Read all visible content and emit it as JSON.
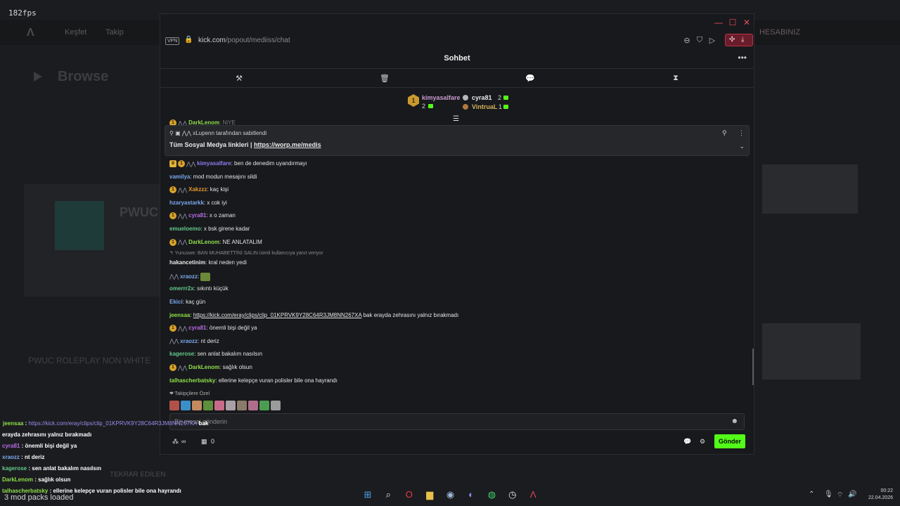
{
  "overlay_fps": "182fps",
  "background": {
    "logo": "Λ",
    "nav": [
      "Keşfet",
      "Takip"
    ],
    "account": "HESABINIZ",
    "browse": "Browse",
    "card_title": "PWUC",
    "stream_title": "PWUC ROLEPLAY NON WHITE",
    "replay": "TEKRAR EDİLEN"
  },
  "window": {
    "controls": {
      "minimize": "—",
      "maximize": "☐",
      "close": "✕"
    }
  },
  "address_bar": {
    "vpn": "VPN",
    "lock_icon": "🔒",
    "domain": "kick.com",
    "path": "/popout/mediiss/chat",
    "icons": [
      "zoom-icon",
      "shield-icon",
      "play-icon"
    ],
    "extensions": [
      "puzzle-icon",
      "download-icon"
    ]
  },
  "chat": {
    "title": "Sohbet",
    "menu": "•••",
    "tabs": [
      {
        "name": "hammer-icon",
        "glyph": "⚒"
      },
      {
        "name": "trash-icon",
        "glyph": "🗑"
      },
      {
        "name": "chat-bubble-icon",
        "glyph": "💬"
      },
      {
        "name": "hourglass-icon",
        "glyph": "⧗"
      }
    ],
    "leaderboard": {
      "first": {
        "rank": "1",
        "name": "kimyasalfare",
        "count": "2",
        "color": "#c99ad0"
      },
      "second": {
        "name": "cyra81",
        "count": "2",
        "color": "#e8e8e8"
      },
      "third": {
        "name": "VintruaL",
        "count": "1",
        "color": "#d4b15a"
      }
    },
    "behind_line": "NiYE",
    "pinned": {
      "meta": "xLupenn tarafından sabitlendi",
      "text": "Tüm Sosyal Medya linkleri | ",
      "link": "https://worp.me/medis"
    },
    "messages": [
      {
        "badges": [
          "crown",
          "gold",
          "wings"
        ],
        "user": "kimyasalfare",
        "color": "#8f7bf2",
        "text": ": ben de denedim uyandırmayı"
      },
      {
        "badges": [],
        "user": "vamilya",
        "color": "#7aa8ee",
        "text": ": mod modun mesajını sildi"
      },
      {
        "badges": [
          "gold",
          "wings"
        ],
        "user": "Xakzzz",
        "color": "#e8952e",
        "text": ": kaç kişi"
      },
      {
        "badges": [],
        "user": "hzaryastarkk",
        "color": "#7aa8ee",
        "text": ": x cok iyi"
      },
      {
        "badges": [
          "gold",
          "wings"
        ],
        "user": "cyra81",
        "color": "#b56be8",
        "text": ": x o zaman"
      },
      {
        "badges": [],
        "user": "emueloemo",
        "color": "#62c98c",
        "text": ": x bsk girene kadar"
      },
      {
        "badges": [
          "gold",
          "wings"
        ],
        "user": "DarkLenom",
        "color": "#8fe04a",
        "text": ": NE ANLATALIM"
      },
      {
        "reply": "↰ Yunuswe: BAN MUHABETTİNİ SALIN isimli kullanıcıya yanıt veriyor",
        "user": "hakancetinim",
        "color": "#e8e8e8",
        "text": ": kral neden yedi"
      },
      {
        "badges": [
          "wings"
        ],
        "user": "xraozz",
        "color": "#7aa8ee",
        "text": ": ",
        "emote": true
      },
      {
        "badges": [],
        "user": "omerrr2x",
        "color": "#62c98c",
        "text": ": sıkıntı küçük"
      },
      {
        "badges": [],
        "user": "Ekici",
        "color": "#7aa8ee",
        "text": ": kaç gün"
      },
      {
        "badges": [],
        "user": "jeensaa",
        "color": "#8fe04a",
        "text": ": ",
        "link": "https://kick.com/eray/clips/clip_01KPRVK9Y28C64R3JM8NN267XA",
        "text_after": " bak erayda zehrasını yalnız bırakmadı"
      },
      {
        "badges": [
          "gold",
          "wings"
        ],
        "user": "cyra81",
        "color": "#b56be8",
        "text": ": önemli bişi değil ya"
      },
      {
        "badges": [
          "wings"
        ],
        "user": "xraozz",
        "color": "#7aa8ee",
        "text": ": nt deriz"
      },
      {
        "badges": [],
        "user": "kagerose",
        "color": "#62c98c",
        "text": ": sen anlat bakalım nasılsın"
      },
      {
        "badges": [
          "gold",
          "wings"
        ],
        "user": "DarkLenom",
        "color": "#8fe04a",
        "text": ": sağlık olsun"
      },
      {
        "badges": [],
        "user": "talhascherbatsky",
        "color": "#8fe04a",
        "text": ": ellerine kelepçe vuran polisler bile ona hayrandı"
      }
    ],
    "followers_label": "❤ Takipçilere Özel",
    "follower_emotes": [
      "#b0524a",
      "#3c8ec8",
      "#c28a5e",
      "#5d8f3c",
      "#c96b88",
      "#a9a0a6",
      "#8a7b6a",
      "#b06e8c",
      "#4b9c52",
      "#9b9b9b"
    ],
    "input_placeholder": "Bir mesaj gönderin",
    "bottom": {
      "users_icon": "users-icon",
      "infinity": "∞",
      "vault_count": "0",
      "send": "Gönder"
    }
  },
  "overlay_chat": [
    {
      "user": "jeensaa",
      "color": "#8fe04a",
      "link": "https://kick.com/eray/clips/clip_01KPRVK9Y28C64R3JM8NN267XA",
      "text": " bak"
    },
    {
      "user": "",
      "color": "#ffffff",
      "text": "erayda zehrasını yalnız bırakmadı"
    },
    {
      "user": "cyra81",
      "color": "#b56be8",
      "text": " : önemli bişi değil ya"
    },
    {
      "user": "xraozz",
      "color": "#7aa8ee",
      "text": " : nt deriz"
    },
    {
      "user": "kagerose",
      "color": "#62c98c",
      "text": " : sen anlat bakalım nasılsın"
    },
    {
      "user": "DarkLenom",
      "color": "#8fe04a",
      "text": " : sağlık olsun"
    },
    {
      "user": "talhascherbatsky",
      "color": "#8fe04a",
      "text": " : ellerine kelepçe vuran polisler bile ona hayrandı"
    }
  ],
  "mod_packs": "3 mod packs loaded",
  "taskbar": {
    "apps": [
      {
        "name": "windows-start-icon",
        "glyph": "⊞",
        "color": "#4aa3f0"
      },
      {
        "name": "search-icon",
        "glyph": "⌕",
        "color": "#e0e0e0"
      },
      {
        "name": "opera-icon",
        "glyph": "O",
        "color": "#e83a4a"
      },
      {
        "name": "file-explorer-icon",
        "glyph": "▆",
        "color": "#e8c04a"
      },
      {
        "name": "steam-icon",
        "glyph": "◉",
        "color": "#9fb8d8"
      },
      {
        "name": "discord-icon",
        "glyph": "◐",
        "color": "#8a8ff0"
      },
      {
        "name": "spotify-icon",
        "glyph": "◍",
        "color": "#3cd46a"
      },
      {
        "name": "clock-app-icon",
        "glyph": "◷",
        "color": "#e0e0e0"
      },
      {
        "name": "kick-app-icon",
        "glyph": "Λ",
        "color": "#e8445a"
      }
    ],
    "time": "00:22",
    "date": "22.04.2026"
  }
}
